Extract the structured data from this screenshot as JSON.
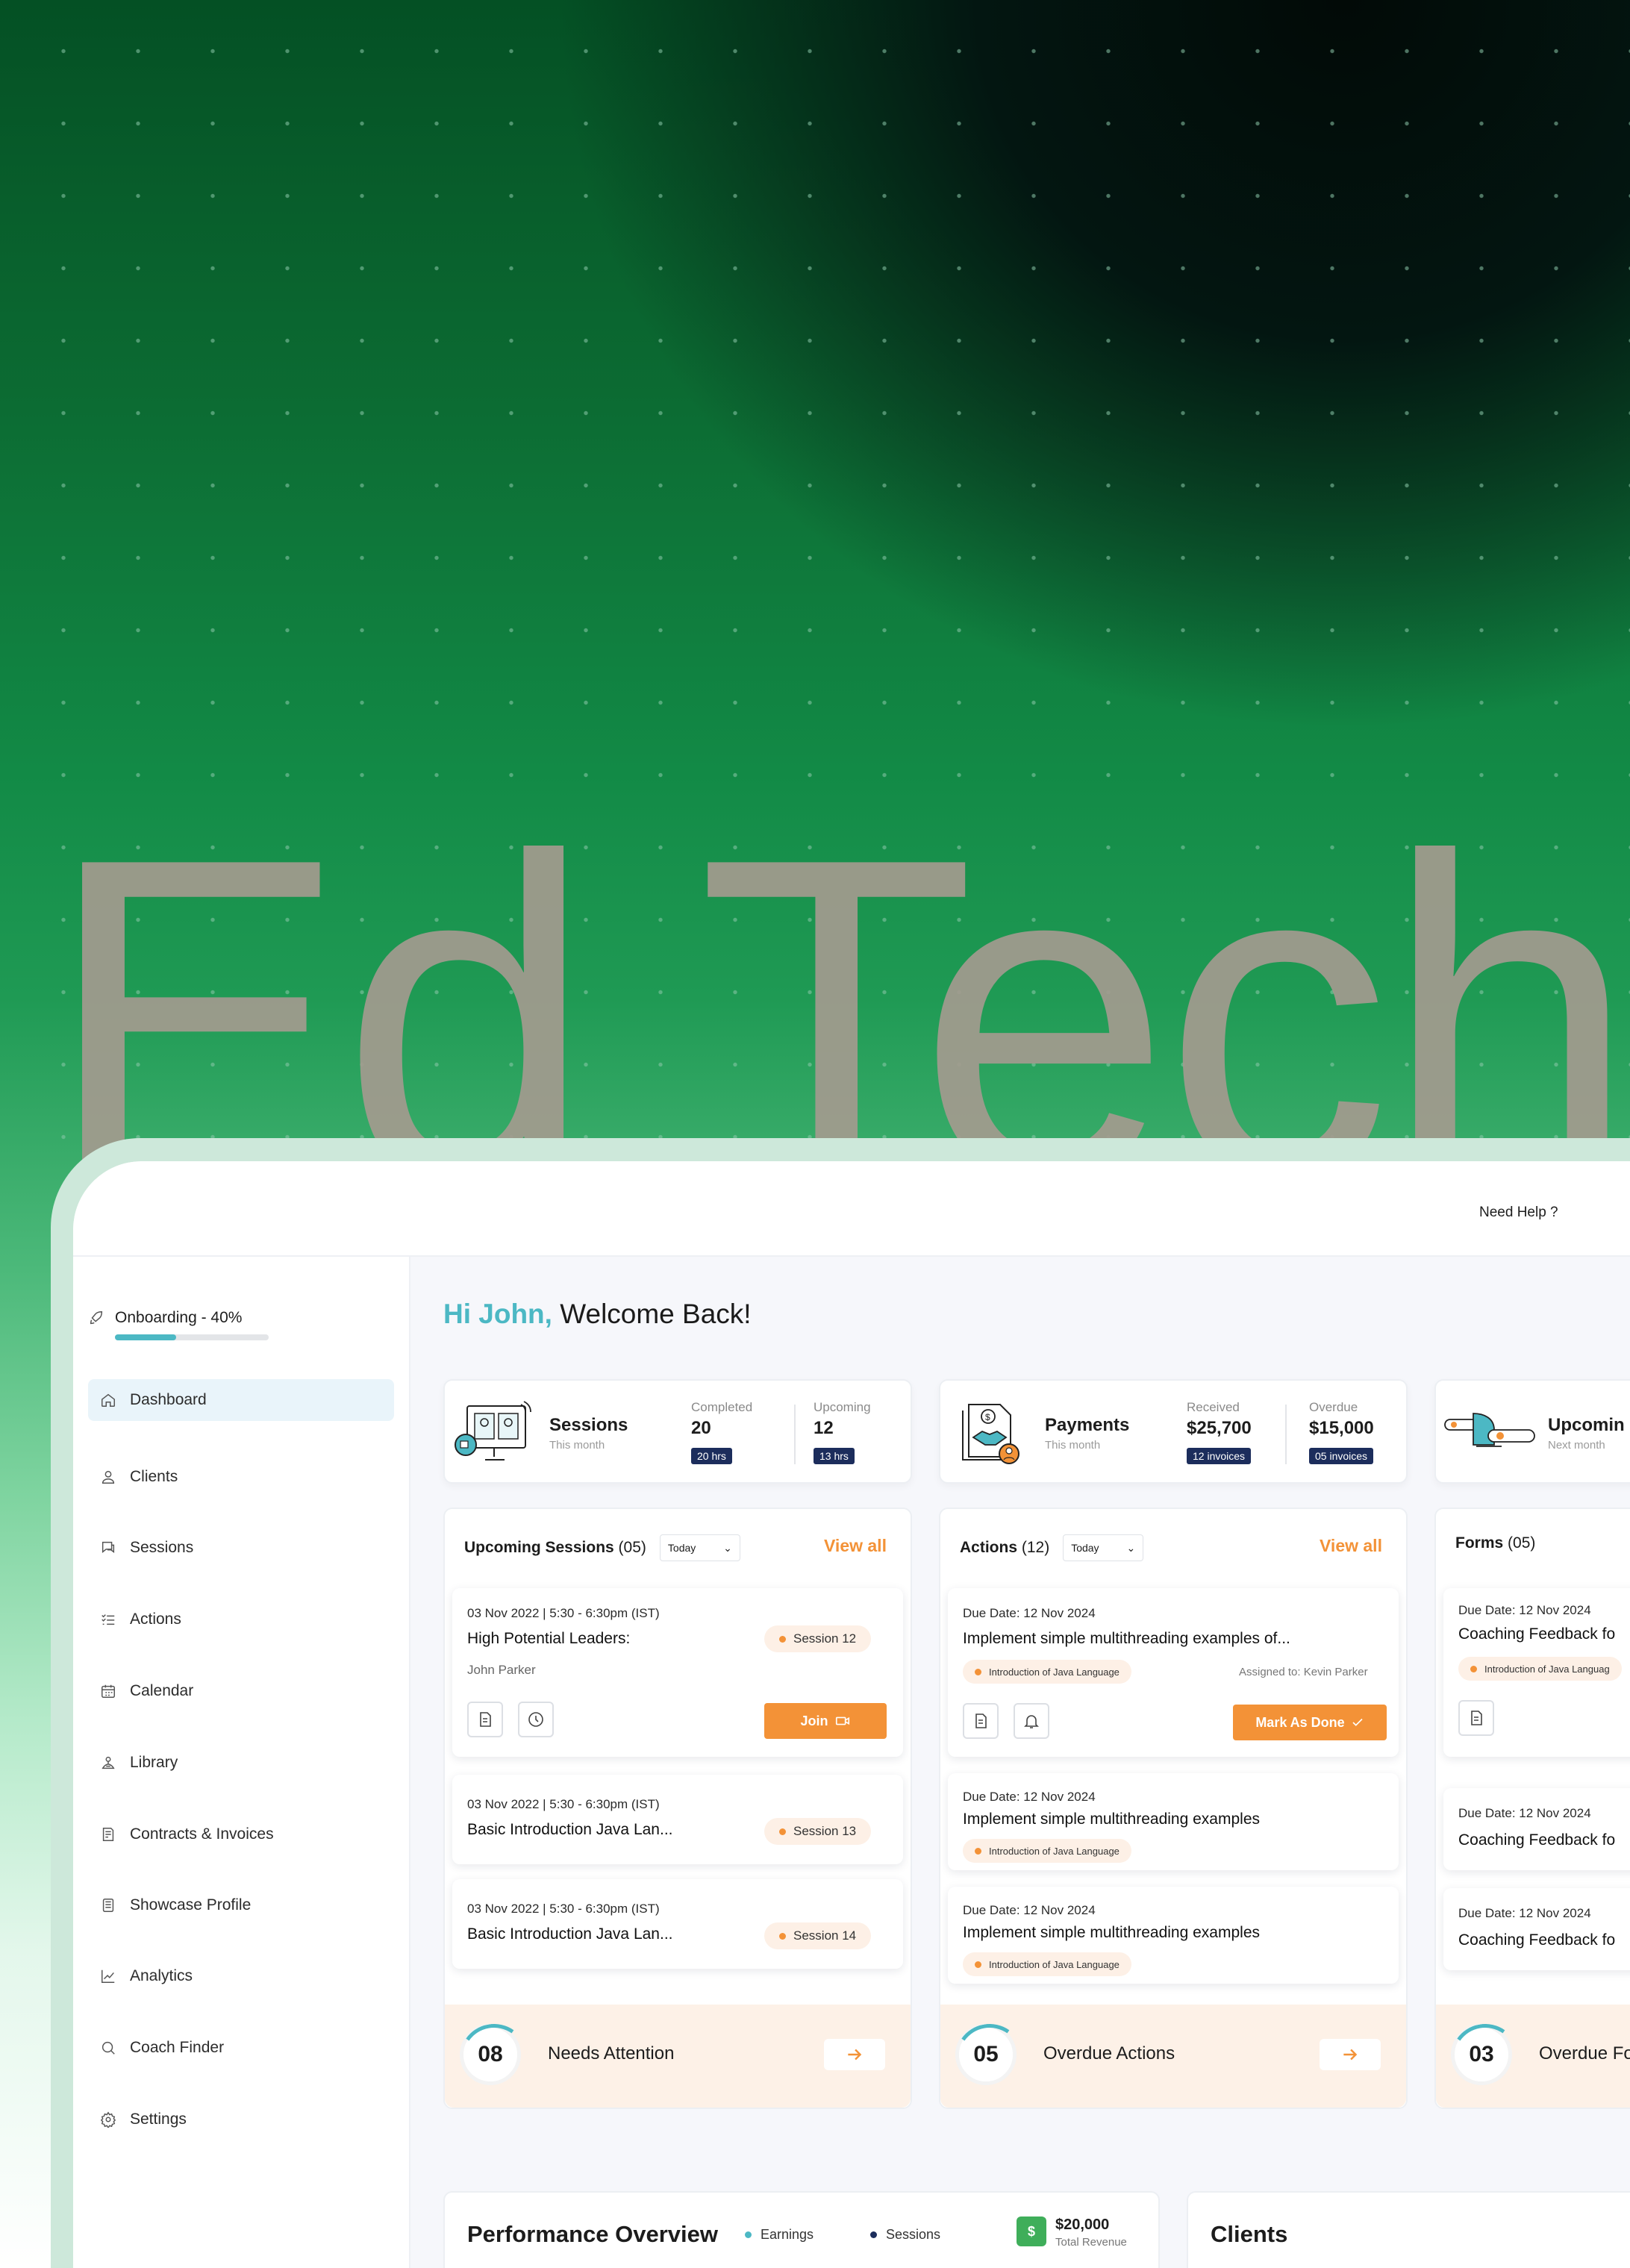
{
  "hero": {
    "title": "Ed Tech"
  },
  "topbar": {
    "need_help": "Need Help ?"
  },
  "sidebar": {
    "onboarding_label": "Onboarding - 40%",
    "onboarding_progress": 0.4,
    "items": [
      {
        "label": "Dashboard",
        "icon": "home-icon",
        "active": true
      },
      {
        "label": "Clients",
        "icon": "user-icon"
      },
      {
        "label": "Sessions",
        "icon": "chat-icon"
      },
      {
        "label": "Actions",
        "icon": "list-check-icon"
      },
      {
        "label": "Calendar",
        "icon": "calendar-icon"
      },
      {
        "label": "Library",
        "icon": "library-icon"
      },
      {
        "label": "Contracts & Invoices",
        "icon": "contract-icon"
      },
      {
        "label": "Showcase Profile",
        "icon": "profile-card-icon"
      },
      {
        "label": "Analytics",
        "icon": "chart-line-icon"
      },
      {
        "label": "Coach Finder",
        "icon": "search-icon"
      },
      {
        "label": "Settings",
        "icon": "gear-icon"
      }
    ]
  },
  "greeting": {
    "hi": "Hi John,",
    "welcome": " Welcome Back!"
  },
  "stats": {
    "sessions": {
      "title": "Sessions",
      "subtitle": "This month",
      "completed_label": "Completed",
      "completed_value": "20",
      "completed_chip": "20 hrs",
      "upcoming_label": "Upcoming",
      "upcoming_value": "12",
      "upcoming_chip": "13 hrs"
    },
    "payments": {
      "title": "Payments",
      "subtitle": "This month",
      "received_label": "Received",
      "received_value": "$25,700",
      "received_chip": "12 invoices",
      "overdue_label": "Overdue",
      "overdue_value": "$15,000",
      "overdue_chip": "05 invoices"
    },
    "upcoming": {
      "title": "Upcomin",
      "subtitle": "Next month"
    }
  },
  "upcoming_sessions": {
    "title": "Upcoming Sessions",
    "count": " (05)",
    "filter": "Today",
    "view_all": "View all",
    "items": [
      {
        "date": "03 Nov 2022 | 5:30 - 6:30pm (IST)",
        "title": "High Potential Leaders:",
        "person": "John Parker",
        "session": "Session 12",
        "join": "Join"
      },
      {
        "date": "03 Nov 2022 | 5:30 - 6:30pm (IST)",
        "title": "Basic Introduction Java Lan...",
        "session": "Session 13"
      },
      {
        "date": "03 Nov 2022 | 5:30 - 6:30pm (IST)",
        "title": "Basic Introduction Java Lan...",
        "session": "Session 14"
      }
    ],
    "attention_count": "08",
    "attention_label": "Needs Attention"
  },
  "actions": {
    "title": "Actions",
    "count": " (12)",
    "filter": "Today",
    "view_all": "View all",
    "items": [
      {
        "due": "Due Date: 12 Nov 2024",
        "title": "Implement simple multithreading examples of...",
        "tag": "Introduction of Java Language",
        "assigned": "Assigned to: Kevin Parker",
        "button": "Mark As Done"
      },
      {
        "due": "Due Date: 12 Nov 2024",
        "title": "Implement simple multithreading examples",
        "tag": "Introduction of Java Language"
      },
      {
        "due": "Due Date: 12 Nov 2024",
        "title": "Implement simple multithreading examples",
        "tag": "Introduction of Java Language"
      }
    ],
    "overdue_count": "05",
    "overdue_label": "Overdue Actions"
  },
  "forms": {
    "title": "Forms",
    "count": " (05)",
    "items": [
      {
        "due": "Due Date: 12 Nov 2024",
        "title": "Coaching Feedback fo",
        "tag": "Introduction of Java Languag"
      },
      {
        "due": "Due Date: 12 Nov 2024",
        "title": "Coaching Feedback fo"
      },
      {
        "due": "Due Date: 12 Nov 2024",
        "title": "Coaching Feedback fo"
      }
    ],
    "overdue_count": "03",
    "overdue_label": "Overdue Fo"
  },
  "performance": {
    "title": "Performance Overview",
    "legend_earnings": "Earnings",
    "legend_sessions": "Sessions",
    "revenue_value": "$20,000",
    "revenue_label": "Total Revenue",
    "revenue_icon": "$"
  },
  "clients": {
    "title": "Clients"
  },
  "colors": {
    "accent_teal": "#4cb8c4",
    "accent_orange": "#f39237",
    "chip_navy": "#1c2d5c",
    "brand_green": "#3fae5a"
  }
}
